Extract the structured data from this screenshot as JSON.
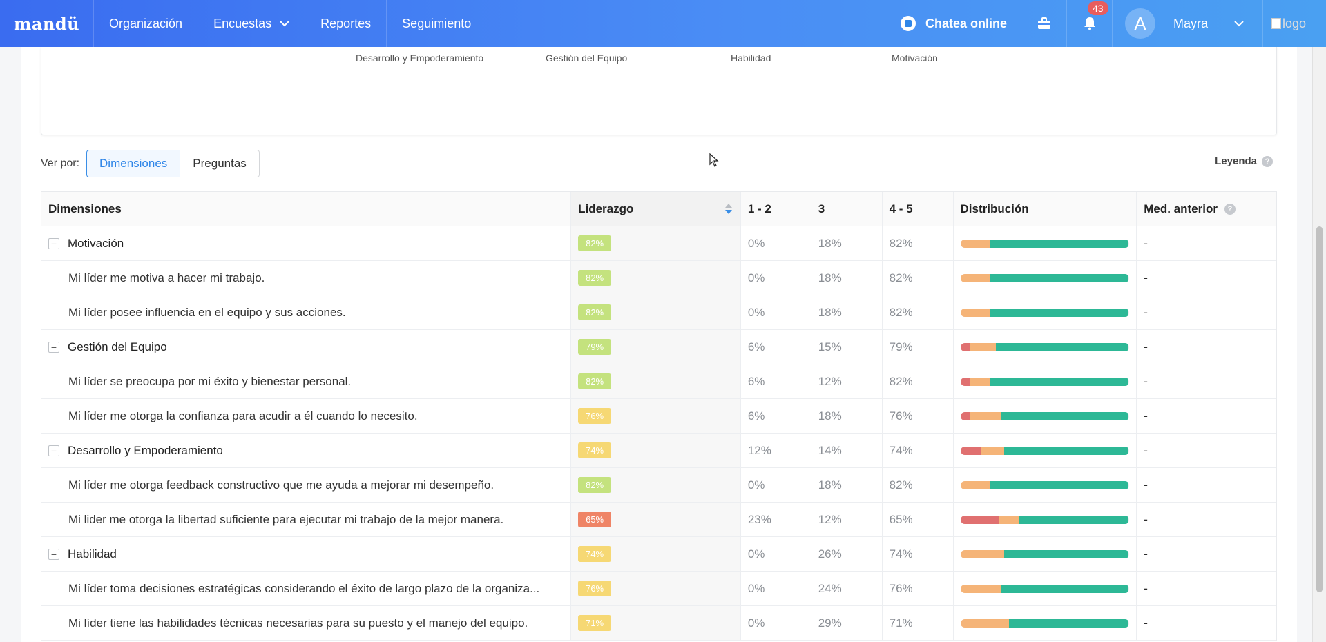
{
  "nav": {
    "brand": "mandü",
    "items": [
      "Organización",
      "Encuestas",
      "Reportes",
      "Seguimiento"
    ],
    "chat_label": "Chatea online",
    "notifications_count": "43",
    "user_initial": "A",
    "user_name": "Mayra",
    "logo_alt": "logo"
  },
  "chart_axis_labels": [
    "Desarrollo y Empoderamiento",
    "Gestión del Equipo",
    "Habilidad",
    "Motivación"
  ],
  "viewby": {
    "label": "Ver por:",
    "options": [
      "Dimensiones",
      "Preguntas"
    ],
    "selected": "Dimensiones",
    "legend_label": "Leyenda"
  },
  "table": {
    "headers": [
      "Dimensiones",
      "Liderazgo",
      "1 - 2",
      "3",
      "4 - 5",
      "Distribución",
      "Med. anterior"
    ],
    "rows": [
      {
        "type": "group",
        "label": "Motivación",
        "score": "82%",
        "low": "0%",
        "mid": "18%",
        "high": "82%",
        "dist": [
          0,
          18,
          82
        ],
        "prev": "-"
      },
      {
        "type": "item",
        "label": "Mi líder me motiva a hacer mi trabajo.",
        "score": "82%",
        "low": "0%",
        "mid": "18%",
        "high": "82%",
        "dist": [
          0,
          18,
          82
        ],
        "prev": "-"
      },
      {
        "type": "item",
        "label": "Mi líder posee influencia en el equipo y sus acciones.",
        "score": "82%",
        "low": "0%",
        "mid": "18%",
        "high": "82%",
        "dist": [
          0,
          18,
          82
        ],
        "prev": "-"
      },
      {
        "type": "group",
        "label": "Gestión del Equipo",
        "score": "79%",
        "low": "6%",
        "mid": "15%",
        "high": "79%",
        "dist": [
          6,
          15,
          79
        ],
        "prev": "-"
      },
      {
        "type": "item",
        "label": "Mi líder se preocupa por mi éxito y bienestar personal.",
        "score": "82%",
        "low": "6%",
        "mid": "12%",
        "high": "82%",
        "dist": [
          6,
          12,
          82
        ],
        "prev": "-"
      },
      {
        "type": "item",
        "label": "Mi líder me otorga la confianza para acudir a él cuando lo necesito.",
        "score": "76%",
        "low": "6%",
        "mid": "18%",
        "high": "76%",
        "dist": [
          6,
          18,
          76
        ],
        "prev": "-"
      },
      {
        "type": "group",
        "label": "Desarrollo y Empoderamiento",
        "score": "74%",
        "low": "12%",
        "mid": "14%",
        "high": "74%",
        "dist": [
          12,
          14,
          74
        ],
        "prev": "-"
      },
      {
        "type": "item",
        "label": "Mi líder me otorga feedback constructivo que me ayuda a mejorar mi desempeño.",
        "score": "82%",
        "low": "0%",
        "mid": "18%",
        "high": "82%",
        "dist": [
          0,
          18,
          82
        ],
        "prev": "-"
      },
      {
        "type": "item",
        "label": "Mi lider me otorga la libertad suficiente para ejecutar mi trabajo de la mejor manera.",
        "score": "65%",
        "low": "23%",
        "mid": "12%",
        "high": "65%",
        "dist": [
          23,
          12,
          65
        ],
        "prev": "-"
      },
      {
        "type": "group",
        "label": "Habilidad",
        "score": "74%",
        "low": "0%",
        "mid": "26%",
        "high": "74%",
        "dist": [
          0,
          26,
          74
        ],
        "prev": "-"
      },
      {
        "type": "item",
        "label": "Mi líder toma decisiones estratégicas considerando el éxito de largo plazo de la organiza...",
        "score": "76%",
        "low": "0%",
        "mid": "24%",
        "high": "76%",
        "dist": [
          0,
          24,
          76
        ],
        "prev": "-"
      },
      {
        "type": "item",
        "label": "Mi líder tiene las habilidades técnicas necesarias para su puesto y el manejo del equipo.",
        "score": "71%",
        "low": "0%",
        "mid": "29%",
        "high": "71%",
        "dist": [
          0,
          29,
          71
        ],
        "prev": "-"
      }
    ]
  },
  "colors": {
    "nav_start": "#3a6cf0",
    "nav_end": "#4aa0f2",
    "score_green": "#c4e27e",
    "score_yellow": "#f6d874",
    "score_red": "#ef8466",
    "dist_low": "#e07070",
    "dist_mid": "#f5b478",
    "dist_high": "#2db896"
  }
}
